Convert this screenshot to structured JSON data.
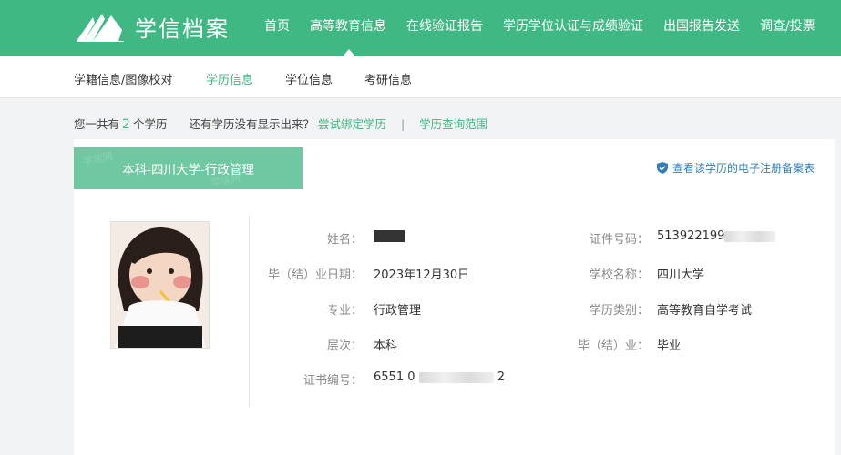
{
  "header": {
    "logo_text": "学信档案",
    "nav": [
      "首页",
      "高等教育信息",
      "在线验证报告",
      "学历学位认证与成绩验证",
      "出国报告发送",
      "调查/投票"
    ]
  },
  "subtabs": [
    "学籍信息/图像校对",
    "学历信息",
    "学位信息",
    "考研信息"
  ],
  "infoline": {
    "prefix": "您一共有",
    "count": "2",
    "suffix": "个学历",
    "question": "还有学历没有显示出来？",
    "bind_link": "尝试绑定学历",
    "separator": "|",
    "scope_link": "学历查询范围"
  },
  "card": {
    "tab_title": "本科-四川大学-行政管理",
    "verify_link": "查看该学历的电子注册备案表",
    "fields": {
      "name_label": "姓名：",
      "grad_date_label": "毕（结）业日期：",
      "grad_date_value": "2023年12月30日",
      "major_label": "专业：",
      "major_value": "行政管理",
      "level_label": "层次：",
      "level_value": "本科",
      "cert_no_label": "证书编号：",
      "cert_no_prefix": "6551 0",
      "cert_no_suffix": "2",
      "id_label": "证件号码：",
      "id_value": "513922199",
      "school_label": "学校名称：",
      "school_value": "四川大学",
      "edu_type_label": "学历类别：",
      "edu_type_value": "高等教育自学考试",
      "status_label": "毕（结）业：",
      "status_value": "毕业"
    }
  },
  "colors": {
    "brand_green": "#3fb883",
    "tab_green": "#70c8a2",
    "link_blue": "#2e7fba"
  }
}
